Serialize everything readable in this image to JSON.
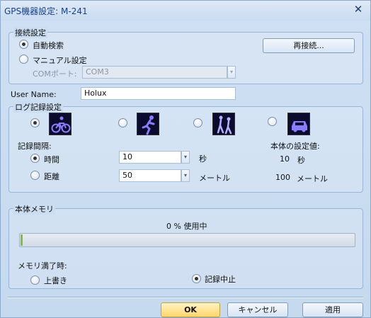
{
  "window": {
    "title": "GPS機器設定: M-241",
    "close_glyph": "✕"
  },
  "connection": {
    "legend": "接続設定",
    "auto_search_label": "自動検索",
    "manual_label": "マニュアル設定",
    "com_port_label": "COMポート:",
    "com_port_value": "COM3",
    "reconnect_label": "再接続..."
  },
  "user": {
    "label": "User Name:",
    "value": "Holux"
  },
  "log_settings": {
    "legend": "ログ記録設定",
    "modes": [
      {
        "icon": "bicycle-icon",
        "selected": true
      },
      {
        "icon": "runner-icon",
        "selected": false
      },
      {
        "icon": "hikers-icon",
        "selected": false
      },
      {
        "icon": "car-icon",
        "selected": false
      }
    ],
    "interval_label": "記録間隔:",
    "time_label": "時間",
    "time_value": "10",
    "time_unit": "秒",
    "distance_label": "距離",
    "distance_value": "50",
    "distance_unit": "メートル",
    "device_values_label": "本体の設定値:",
    "device_time_value": "10",
    "device_time_unit": "秒",
    "device_distance_value": "100",
    "device_distance_unit": "メートル",
    "selected_interval": "time"
  },
  "memory": {
    "legend": "本体メモリ",
    "usage_text": "0 % 使用中",
    "usage_percent": 0,
    "full_label": "メモリ満了時:",
    "overwrite_label": "上書き",
    "stop_label": "記録中止",
    "selected_action": "stop"
  },
  "buttons": {
    "ok": "OK",
    "cancel": "キャンセル",
    "apply": "適用"
  },
  "colors": {
    "ok_button": "#ffd66b",
    "progress_fill": "#7ac23f",
    "icon_purple": "#7a6bff"
  }
}
